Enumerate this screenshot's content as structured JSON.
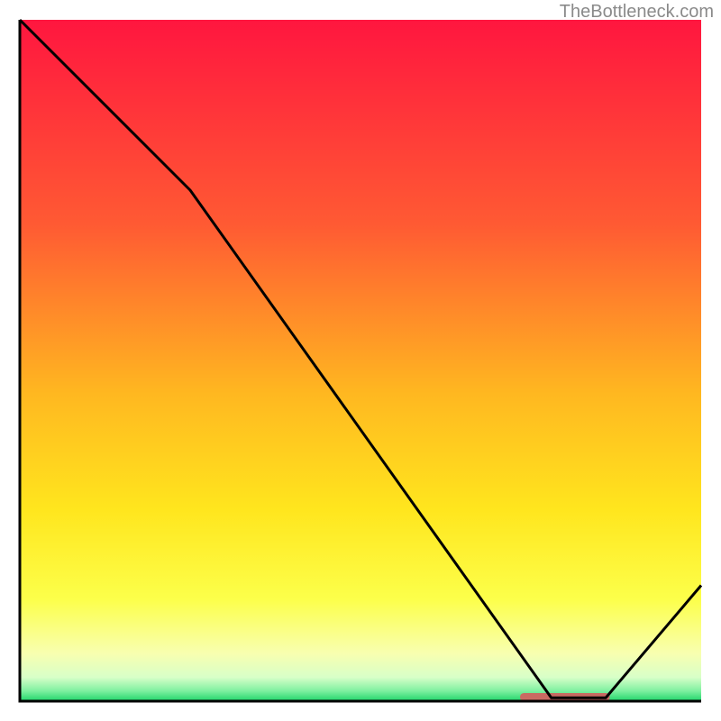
{
  "attribution": "TheBottleneck.com",
  "chart_data": {
    "type": "line",
    "title": "",
    "xlabel": "",
    "ylabel": "",
    "xlim": [
      0,
      100
    ],
    "ylim": [
      0,
      100
    ],
    "x": [
      0,
      25,
      78,
      86,
      100
    ],
    "values": [
      100,
      75,
      0.5,
      0.5,
      17
    ],
    "marker": {
      "x_start": 74,
      "x_end": 86,
      "y": 0.6
    },
    "gradient_stops": [
      {
        "offset": 0.0,
        "color": "#ff163f"
      },
      {
        "offset": 0.3,
        "color": "#ff5a33"
      },
      {
        "offset": 0.55,
        "color": "#ffb820"
      },
      {
        "offset": 0.72,
        "color": "#ffe61e"
      },
      {
        "offset": 0.85,
        "color": "#fcff4a"
      },
      {
        "offset": 0.93,
        "color": "#f8ffb0"
      },
      {
        "offset": 0.965,
        "color": "#d8ffc8"
      },
      {
        "offset": 0.985,
        "color": "#7ef0a0"
      },
      {
        "offset": 1.0,
        "color": "#1fd46a"
      }
    ],
    "marker_color": "#c96a62",
    "line_color": "#000000",
    "border_color": "#000000"
  }
}
